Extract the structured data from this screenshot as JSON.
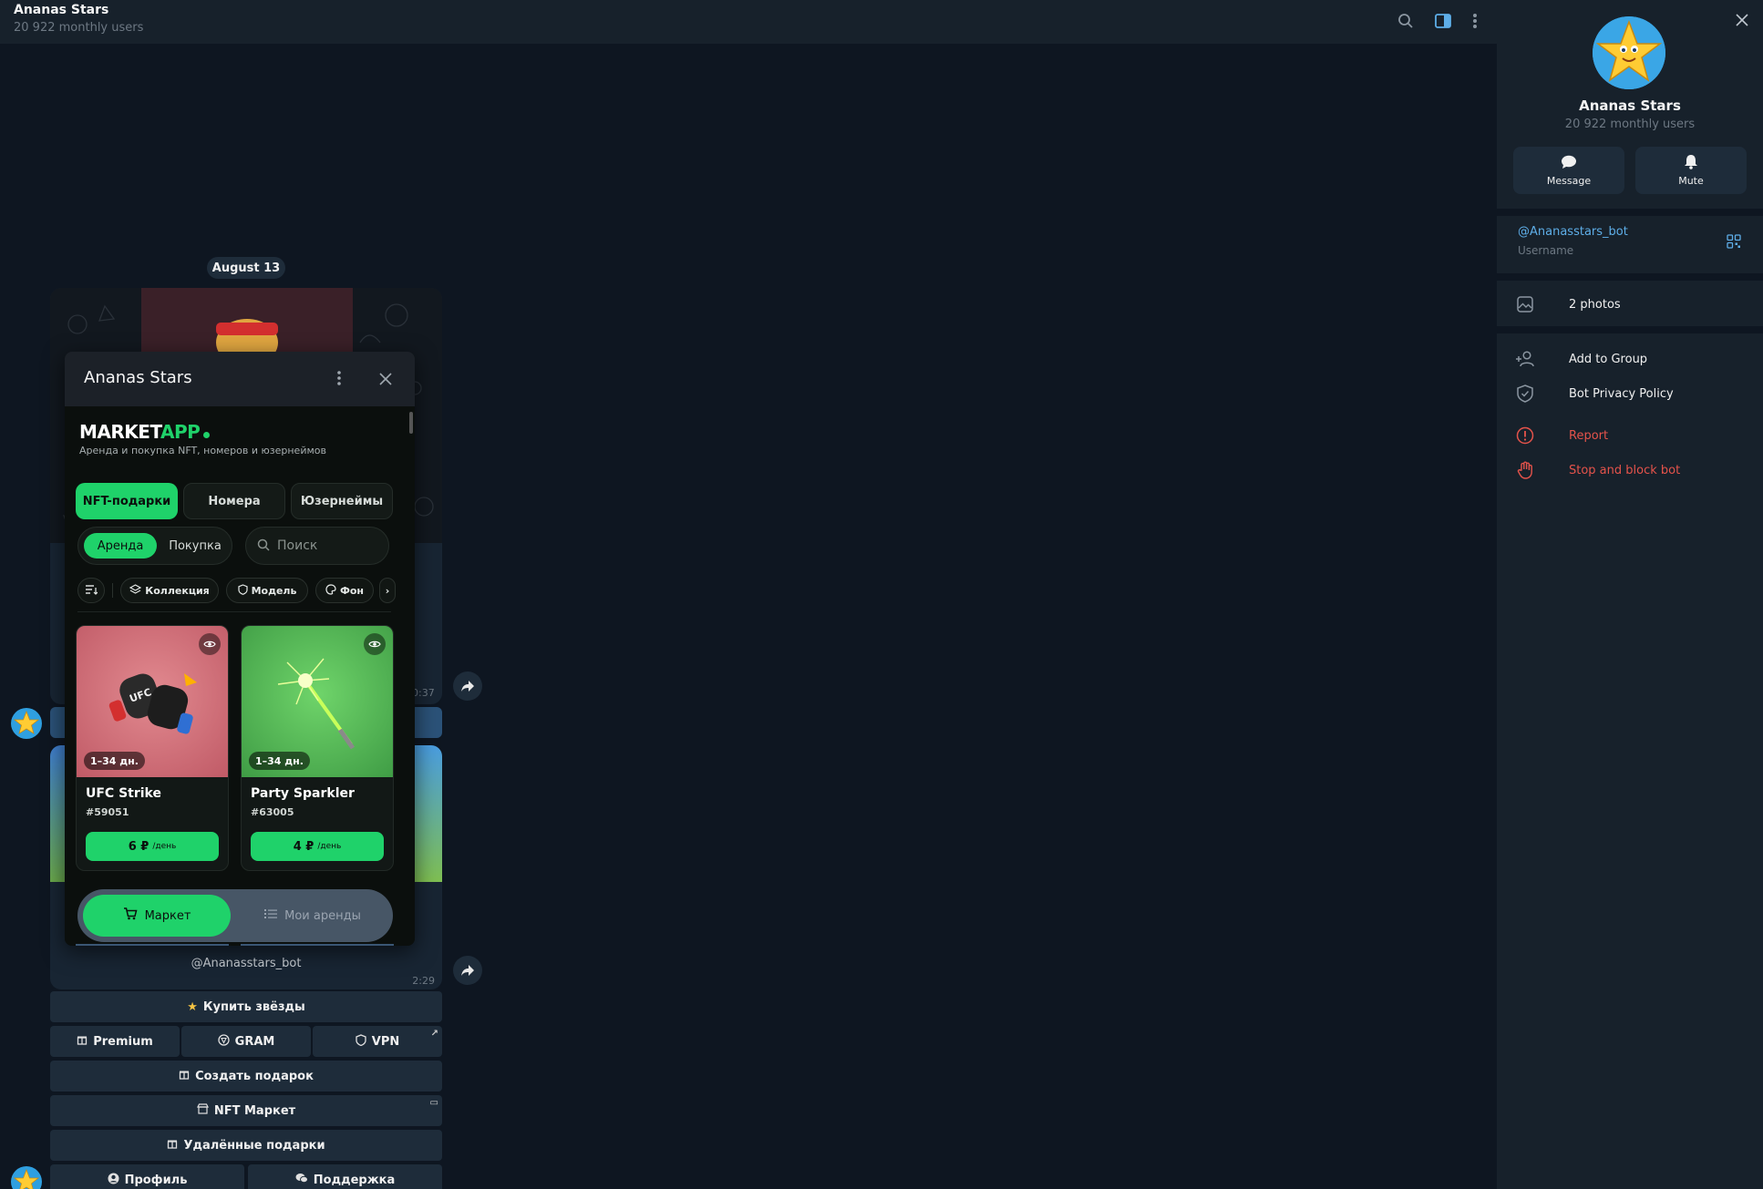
{
  "header": {
    "title": "Ananas Stars",
    "subtitle": "20 922 monthly users"
  },
  "chat": {
    "date_label": "August 13",
    "msg1_time": "0:37",
    "msg2_time": "2:29",
    "msg2_bot_handle": "@Ananasstars_bot"
  },
  "keyboard": {
    "buy_stars": "Купить звёзды",
    "premium": "Premium",
    "gram": "GRAM",
    "vpn": "VPN",
    "create_gift": "Создать подарок",
    "nft_market": "NFT Маркет",
    "deleted_gifts": "Удалённые подарки",
    "profile": "Профиль",
    "support": "Поддержка"
  },
  "miniapp": {
    "title": "Ananas Stars",
    "logo_market": "MARKET",
    "logo_app": "APP",
    "tagline": "Аренда и покупка NFT, номеров и юзернеймов",
    "segments": [
      "NFT-подарки",
      "Номера",
      "Юзернеймы"
    ],
    "toggle_rent": "Аренда",
    "toggle_buy": "Покупка",
    "search_placeholder": "Поиск",
    "filters": {
      "collection": "Коллекция",
      "model": "Модель",
      "background": "Фон"
    },
    "cards": [
      {
        "duration": "1–34 дн.",
        "name": "UFC Strike",
        "number": "#59051",
        "price": "6 ₽",
        "per_day": "/день"
      },
      {
        "duration": "1–34 дн.",
        "name": "Party Sparkler",
        "number": "#63005",
        "price": "4 ₽",
        "per_day": "/день"
      }
    ],
    "nav": {
      "market": "Маркет",
      "my_rentals": "Мои аренды"
    }
  },
  "profile_panel": {
    "name": "Ananas Stars",
    "subtitle": "20 922 monthly users",
    "message_label": "Message",
    "mute_label": "Mute",
    "username_value": "@Ananasstars_bot",
    "username_caption": "Username",
    "photos_label": "2 photos",
    "add_to_group": "Add to Group",
    "privacy_policy": "Bot Privacy Policy",
    "report": "Report",
    "stop_block": "Stop and block bot"
  },
  "colors": {
    "accent_green": "#1fd26a",
    "link_blue": "#5eaee8",
    "danger_red": "#e5534b",
    "chat_bg": "#0e1621",
    "panel_bg": "#17212b"
  }
}
